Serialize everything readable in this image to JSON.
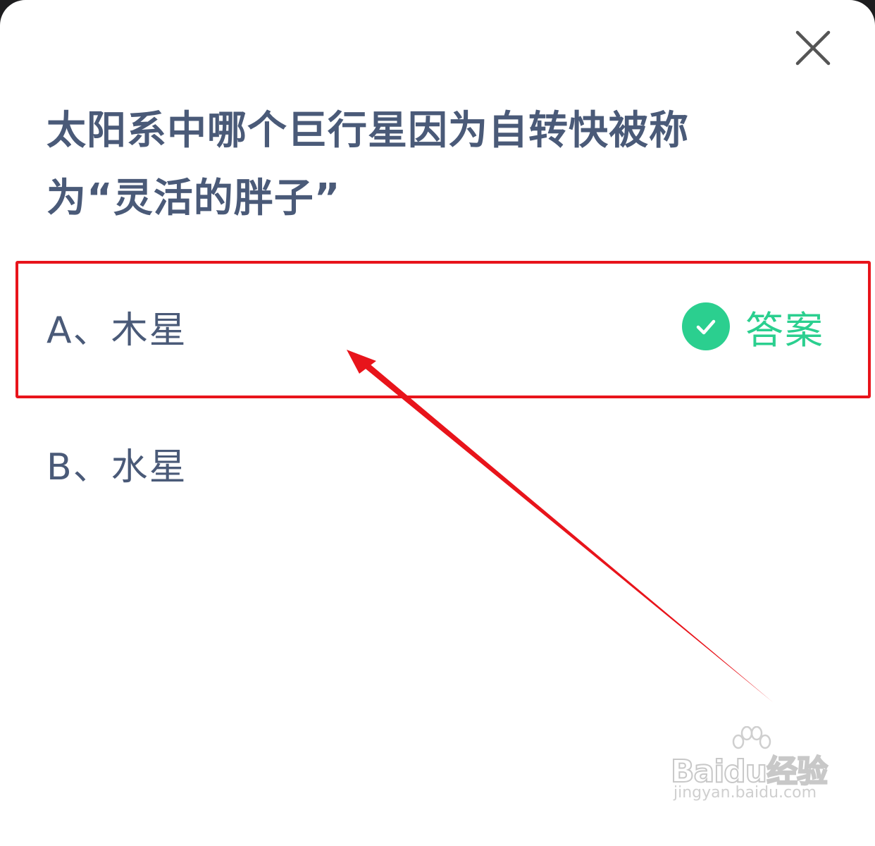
{
  "dialog": {
    "question": "太阳系中哪个巨行星因为自转快被称为“灵活的胖子”",
    "options": [
      {
        "label": "A、木星",
        "is_answer": true
      },
      {
        "label": "B、水星",
        "is_answer": false
      }
    ],
    "answer_label": "答案"
  },
  "colors": {
    "question_text": "#4a5a78",
    "answer_green": "#2bcf8f",
    "annotation_red": "#e8141b"
  },
  "icons": {
    "close": "close-icon",
    "check": "check-circle-icon"
  },
  "watermark": {
    "brand": "Baidu经验",
    "url": "jingyan.baidu.com"
  }
}
